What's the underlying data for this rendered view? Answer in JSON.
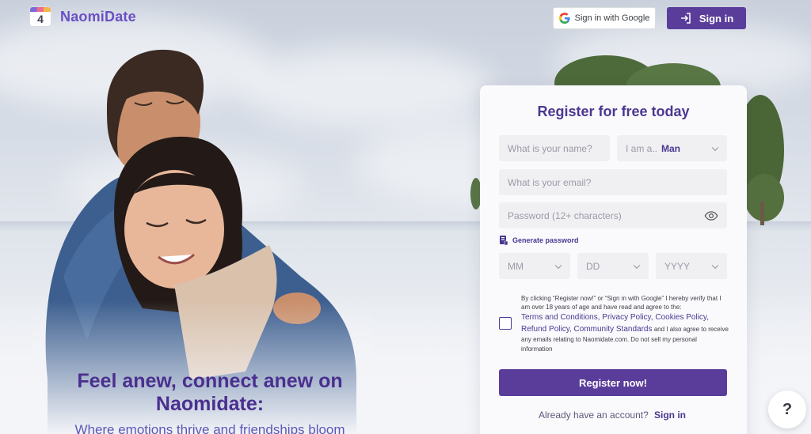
{
  "header": {
    "logo_number": "4",
    "brand": "NaomiDate",
    "google_signin_label": "Sign in with Google",
    "signin_label": "Sign in"
  },
  "hero": {
    "headline": "Feel anew, connect anew on Naomidate:",
    "subline": "Where emotions thrive and friendships bloom"
  },
  "form": {
    "title": "Register for free today",
    "name_placeholder": "What is your name?",
    "gender_prefix": "I am a..",
    "gender_value": "Man",
    "email_placeholder": "What is your email?",
    "password_placeholder": "Password (12+ characters)",
    "generate_password": "Generate password",
    "month_placeholder": "MM",
    "day_placeholder": "DD",
    "year_placeholder": "YYYY",
    "terms_intro": "By clicking “Register now!” or “Sign in with Google” I hereby verify that I am over 18 years of age and have read and agree to the:",
    "link_terms": "Terms and Conditions",
    "link_privacy": "Privacy Policy",
    "link_cookies": "Cookies Policy",
    "link_refund": "Refund Policy",
    "link_community": "Community Standards",
    "terms_outro": "and I also agree to receive any emails relating to Naomidate.com. Do not sell my personal information",
    "register_label": "Register now!",
    "already_text": "Already have an account?",
    "already_signin": "Sign in"
  },
  "help": {
    "label": "?"
  },
  "colors": {
    "brand": "#5a3d9a",
    "title": "#4b3791",
    "field_bg": "#f0f0f3"
  }
}
